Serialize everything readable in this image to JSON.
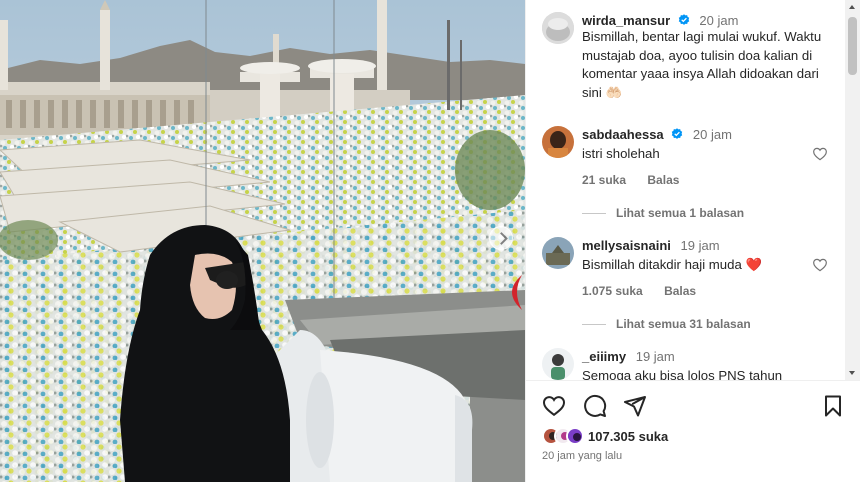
{
  "post": {
    "author": "wirda_mansur",
    "time": "20 jam",
    "caption": "Bismillah, bentar lagi mulai wukuf. Waktu mustajab doa, ayoo tulisin doa kalian di komentar yaaa insya Allah didoakan dari sini 🤲🏻"
  },
  "comments": [
    {
      "username": "sabdaahessa",
      "verified": true,
      "time": "20 jam",
      "text": "istri sholehah",
      "likes": "21 suka",
      "reply": "Balas",
      "view_replies": "Lihat semua 1 balasan"
    },
    {
      "username": "mellysaisnaini",
      "verified": false,
      "time": "19 jam",
      "text": "Bismillah ditakdir haji muda ❤️",
      "likes": "1.075 suka",
      "reply": "Balas",
      "view_replies": "Lihat semua 31 balasan"
    },
    {
      "username": "_eiiimy",
      "verified": false,
      "time": "19 jam",
      "text": "Semoga aku bisa lolos PNS tahun"
    }
  ],
  "actions": {
    "icons": [
      "heart-icon",
      "comment-icon",
      "share-icon",
      "bookmark-icon"
    ]
  },
  "likes": {
    "count": "107.305 suka"
  },
  "posted_ago": "20 jam yang lalu",
  "colors": {
    "verified": "#0095f6",
    "heart_red": "#e0242f",
    "text": "#262626",
    "muted": "#737373"
  }
}
